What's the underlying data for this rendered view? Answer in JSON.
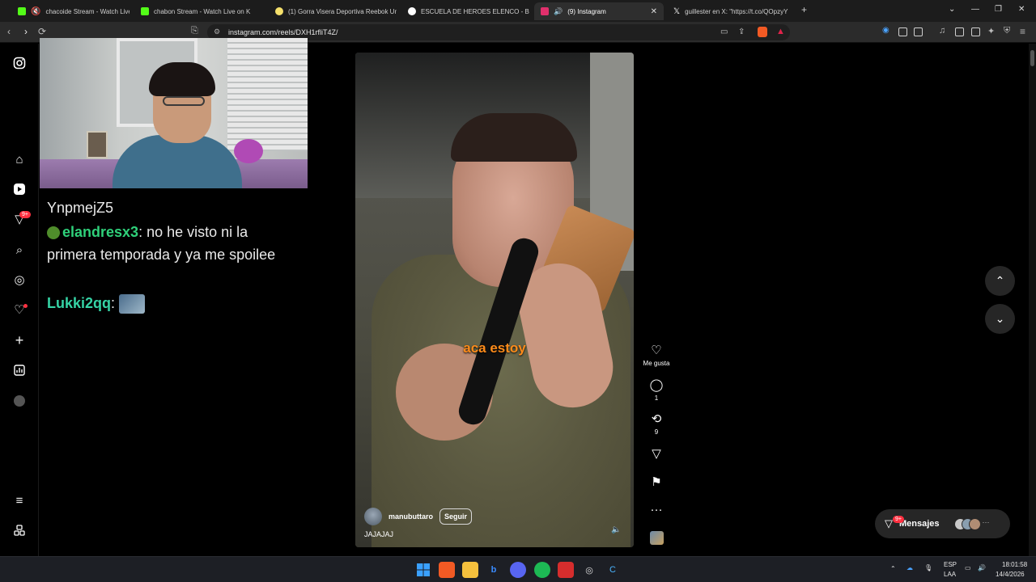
{
  "browser": {
    "tabs": [
      {
        "label": "chacoide Stream - Watch Live on",
        "fav_color": "#53fc18",
        "active": false
      },
      {
        "label": "chabon Stream - Watch Live on K",
        "fav_color": "#53fc18",
        "active": false
      },
      {
        "label": "(1) Gorra Visera Deportiva Reebok Un",
        "fav_color": "#f5e06b",
        "active": false
      },
      {
        "label": "ESCUELA DE HEROES ELENCO - Busc",
        "fav_color": "#ffffff",
        "active": false
      },
      {
        "label": "(9) Instagram",
        "fav_color": "#e1306c",
        "active": true
      },
      {
        "label": "guillester en X: \"https://t.co/QOpzyY",
        "fav_color": "#ffffff",
        "active": false
      }
    ],
    "url": "instagram.com/reels/DXH1rfliT4Z/"
  },
  "sidebar": {
    "notifications_badge": "9+"
  },
  "chat": {
    "line0": "YnpmejZ5",
    "line1_user": "elandresx3",
    "line1_msg": ": no he visto ni la primera temporada y ya me spoilee",
    "line2_user": "Lukki2qq",
    "line2_sep": ":"
  },
  "reel": {
    "caption": "aca estoy",
    "username": "manubuttaro",
    "follow": "Seguir",
    "description": "JAJAJAJ"
  },
  "actions": {
    "like_label": "Me gusta",
    "comments": "1",
    "reposts": "9"
  },
  "messages": {
    "label": "Mensajes",
    "badge": "9+"
  },
  "taskbar": {
    "lang": "ESP",
    "lang2": "LAA",
    "time": "18:01:58",
    "date": "14/4/2026"
  }
}
